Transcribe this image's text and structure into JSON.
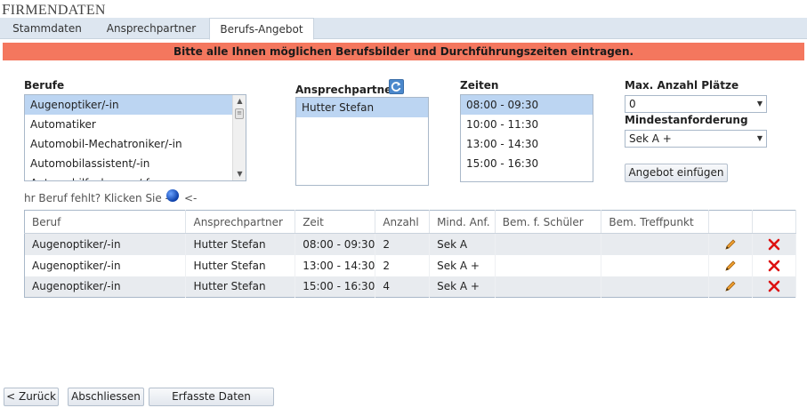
{
  "page": {
    "title_cap": "F",
    "title_rest": "IRMENDATEN"
  },
  "tabs": [
    {
      "label": "Stammdaten",
      "active": false
    },
    {
      "label": "Ansprechpartner",
      "active": false
    },
    {
      "label": "Berufs-Angebot",
      "active": true
    }
  ],
  "alert": {
    "text": "Bitte alle Ihnen möglichen Berufsbilder und Durchführungszeiten eintragen.",
    "color": "#f4775e"
  },
  "berufe": {
    "label": "Berufe",
    "items": [
      "Augenoptiker/-in",
      "Automatiker",
      "Automobil-Mechatroniker/-in",
      "Automobilassistent/-in",
      "Automobilfachmann/-frau"
    ],
    "selected": "Augenoptiker/-in"
  },
  "ansprechpartner": {
    "label": "Ansprechpartner",
    "refresh_icon": "refresh-icon",
    "items": [
      "Hutter Stefan"
    ],
    "selected": "Hutter Stefan"
  },
  "zeiten": {
    "label": "Zeiten",
    "items": [
      "08:00 - 09:30",
      "10:00 - 11:30",
      "13:00 - 14:30",
      "15:00 - 16:30"
    ],
    "selected": "08:00 - 09:30"
  },
  "max_plaetze": {
    "label": "Max. Anzahl Plätze",
    "value": "0"
  },
  "mindestanforderung": {
    "label": "Mindestanforderung",
    "value": "Sek A +"
  },
  "angebot_button": "Angebot einfügen",
  "hint": {
    "text": "hr Beruf fehlt? Klicken Sie ->",
    "suffix": "<-"
  },
  "table": {
    "headers": [
      "Beruf",
      "Ansprechpartner",
      "Zeit",
      "Anzahl",
      "Mind. Anf.",
      "Bem. f. Schüler",
      "Bem. Treffpunkt",
      "",
      ""
    ],
    "rows": [
      {
        "beruf": "Augenoptiker/-in",
        "ansprechpartner": "Hutter Stefan",
        "zeit": "08:00 - 09:30",
        "anzahl": "2",
        "mind": "Sek A",
        "bem_schueler": "",
        "bem_treffpunkt": ""
      },
      {
        "beruf": "Augenoptiker/-in",
        "ansprechpartner": "Hutter Stefan",
        "zeit": "13:00 - 14:30",
        "anzahl": "2",
        "mind": "Sek A +",
        "bem_schueler": "",
        "bem_treffpunkt": ""
      },
      {
        "beruf": "Augenoptiker/-in",
        "ansprechpartner": "Hutter Stefan",
        "zeit": "15:00 - 16:30",
        "anzahl": "4",
        "mind": "Sek A +",
        "bem_schueler": "",
        "bem_treffpunkt": ""
      }
    ]
  },
  "footer": {
    "back": "< Zurück",
    "finish": "Abschliessen",
    "print": "Erfasste Daten drucken"
  }
}
